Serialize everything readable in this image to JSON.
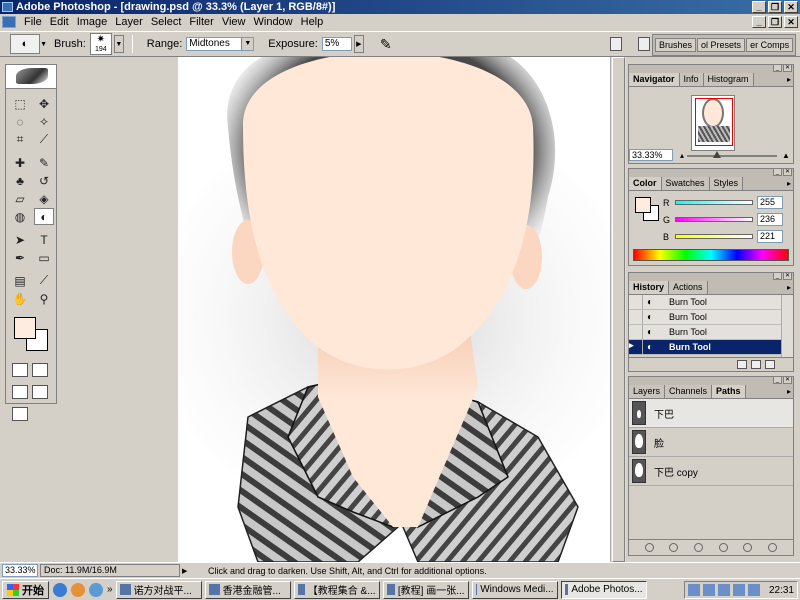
{
  "window": {
    "title": "Adobe Photoshop - [drawing.psd @ 33.3% (Layer 1, RGB/8#)]",
    "controls": [
      "_",
      "❐",
      "✕"
    ]
  },
  "menubar": {
    "items": [
      "File",
      "Edit",
      "Image",
      "Layer",
      "Select",
      "Filter",
      "View",
      "Window",
      "Help"
    ],
    "doc_controls": [
      "_",
      "❐",
      "✕"
    ]
  },
  "options": {
    "brush_label": "Brush:",
    "brush_size": "194",
    "range_label": "Range:",
    "range_value": "Midtones",
    "exposure_label": "Exposure:",
    "exposure_value": "5%",
    "palette_well_tabs": [
      "Brushes",
      "ol Presets",
      "er Comps"
    ]
  },
  "navigator": {
    "tabs": [
      "Navigator",
      "Info",
      "Histogram"
    ],
    "zoom": "33.33%"
  },
  "color": {
    "tabs": [
      "Color",
      "Swatches",
      "Styles"
    ],
    "channels": [
      {
        "label": "R",
        "value": "255",
        "gradient": "#0ff"
      },
      {
        "label": "G",
        "value": "236",
        "gradient": "#f0f"
      },
      {
        "label": "B",
        "value": "221",
        "gradient": "#ff0"
      }
    ],
    "foreground": "#ffece0",
    "background": "#ffffff"
  },
  "history": {
    "tabs": [
      "History",
      "Actions"
    ],
    "items": [
      "Burn Tool",
      "Burn Tool",
      "Burn Tool",
      "Burn Tool"
    ],
    "selected_index": 3
  },
  "paths": {
    "tabs": [
      "Layers",
      "Channels",
      "Paths"
    ],
    "items": [
      "下巴",
      "脸",
      "下巴 copy"
    ]
  },
  "status": {
    "zoom": "33.33%",
    "doc": "Doc: 11.9M/16.9M",
    "hint": "Click and drag to darken.  Use Shift, Alt, and Ctrl for additional options."
  },
  "taskbar": {
    "start": "开始",
    "more": "»",
    "tasks": [
      "诺方对战平...",
      "香港金融管...",
      "【教程集合 &...",
      "[教程] 画一张...",
      "Windows Medi...",
      "Adobe Photos..."
    ],
    "active_task": 5,
    "clock": "22:31"
  }
}
